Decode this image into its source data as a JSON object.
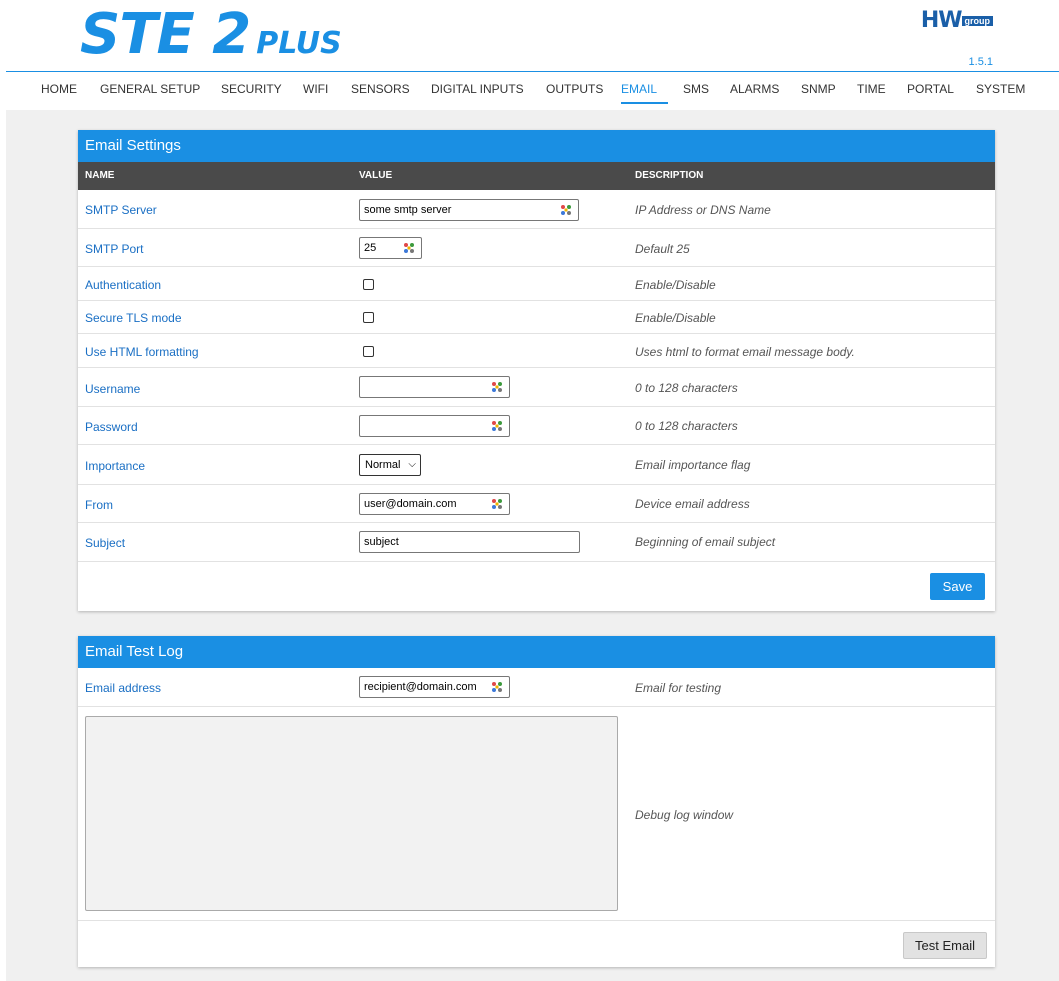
{
  "header": {
    "logo_main": "STE 2",
    "logo_sub": "PLUS",
    "brand_hw": "HW",
    "brand_group": "group",
    "version": "1.5.1"
  },
  "nav": [
    {
      "label": "HOME"
    },
    {
      "label": "GENERAL SETUP"
    },
    {
      "label": "SECURITY"
    },
    {
      "label": "WIFI"
    },
    {
      "label": "SENSORS"
    },
    {
      "label": "DIGITAL INPUTS"
    },
    {
      "label": "OUTPUTS"
    },
    {
      "label": "EMAIL",
      "active": true
    },
    {
      "label": "SMS"
    },
    {
      "label": "ALARMS"
    },
    {
      "label": "SNMP"
    },
    {
      "label": "TIME"
    },
    {
      "label": "PORTAL"
    },
    {
      "label": "SYSTEM"
    }
  ],
  "email_settings": {
    "title": "Email Settings",
    "columns": {
      "name": "NAME",
      "value": "VALUE",
      "description": "DESCRIPTION"
    },
    "rows": {
      "smtp_server": {
        "name": "SMTP Server",
        "value": "some smtp server",
        "desc": "IP Address or DNS Name"
      },
      "smtp_port": {
        "name": "SMTP Port",
        "value": "25",
        "desc": "Default 25"
      },
      "authentication": {
        "name": "Authentication",
        "checked": false,
        "desc": "Enable/Disable"
      },
      "secure_tls": {
        "name": "Secure TLS mode",
        "checked": false,
        "desc": "Enable/Disable"
      },
      "html_formatting": {
        "name": "Use HTML formatting",
        "checked": false,
        "desc": "Uses html to format email message body."
      },
      "username": {
        "name": "Username",
        "value": "",
        "desc": "0 to 128 characters"
      },
      "password": {
        "name": "Password",
        "value": "",
        "desc": "0 to 128 characters"
      },
      "importance": {
        "name": "Importance",
        "value": "Normal",
        "desc": "Email importance flag"
      },
      "from": {
        "name": "From",
        "value": "user@domain.com",
        "desc": "Device email address"
      },
      "subject": {
        "name": "Subject",
        "value": "subject",
        "desc": "Beginning of email subject"
      }
    },
    "save_label": "Save"
  },
  "email_test": {
    "title": "Email Test Log",
    "address": {
      "name": "Email address",
      "value": "recipient@domain.com",
      "desc": "Email for testing"
    },
    "log_desc": "Debug log window",
    "test_label": "Test Email"
  },
  "colors": {
    "accent": "#1a8fe3",
    "header_dark": "#4a4a4a",
    "page_bg": "#f0f0f0"
  },
  "icons": {
    "field_icon": "key-icon",
    "select_chevron": "chevron-down-icon"
  }
}
